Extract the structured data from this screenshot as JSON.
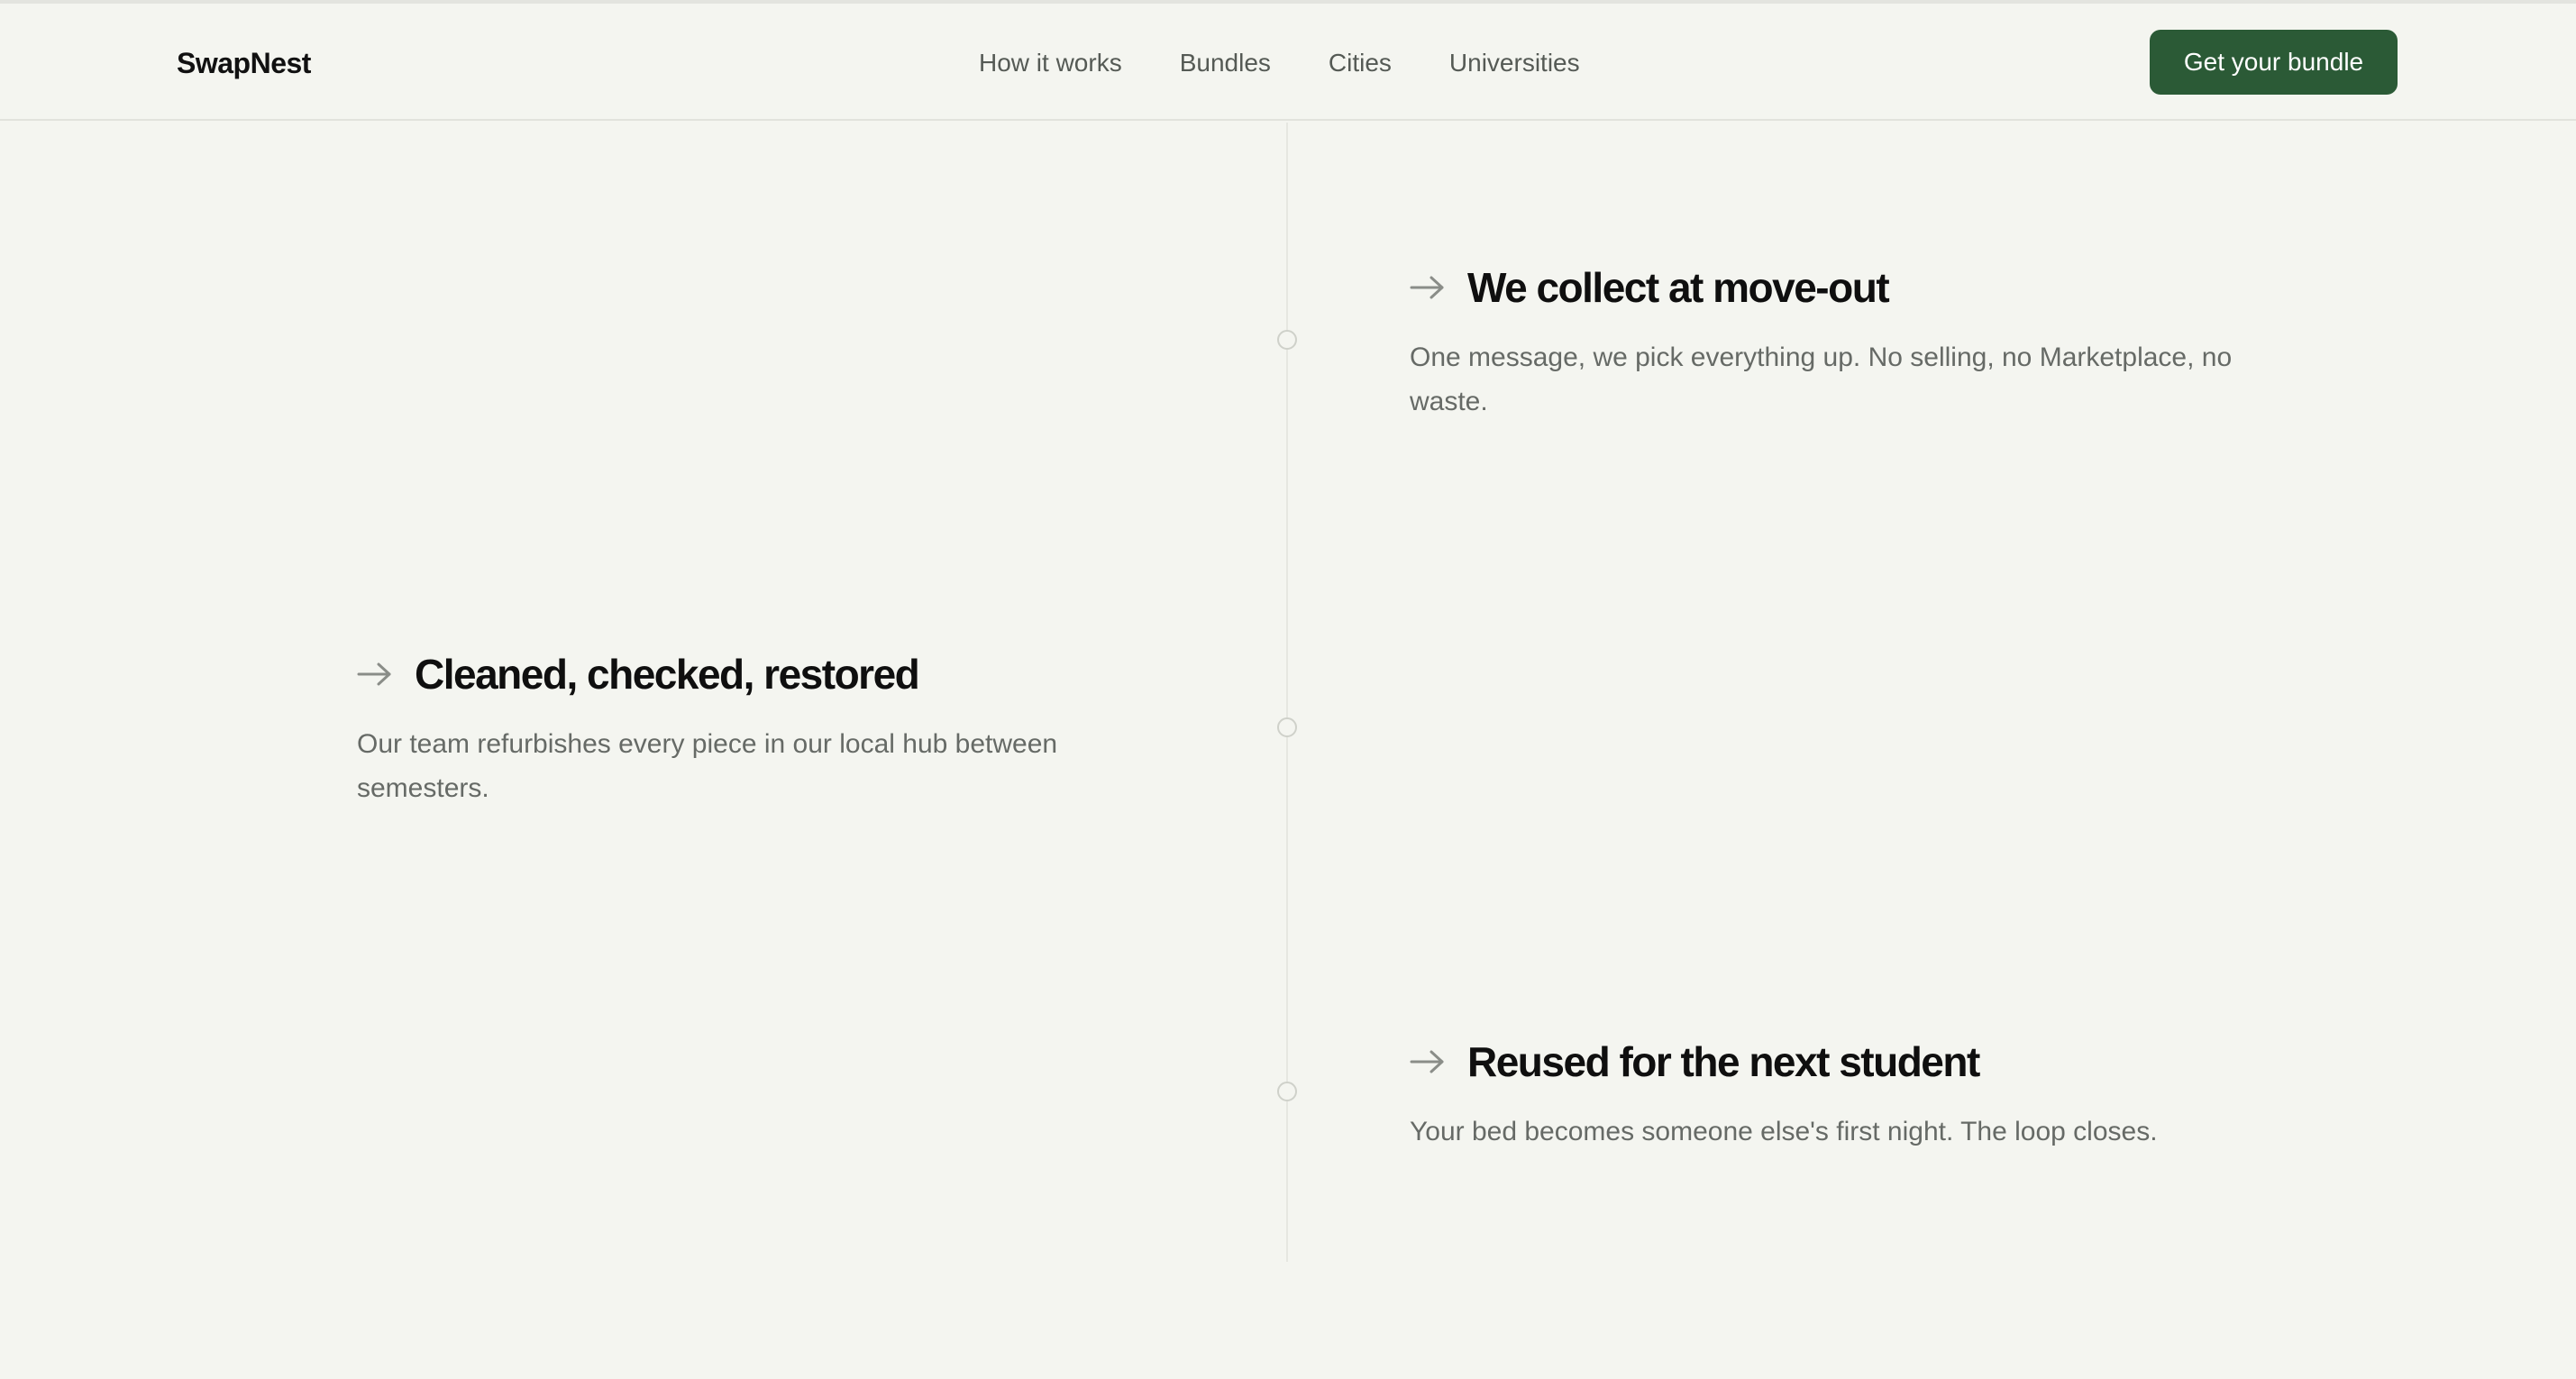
{
  "header": {
    "brand": "SwapNest",
    "nav": [
      "How it works",
      "Bundles",
      "Cities",
      "Universities"
    ],
    "cta_label": "Get your bundle"
  },
  "steps": [
    {
      "title": "We collect at move-out",
      "description": "One message, we pick everything up. No selling, no Marketplace, no waste.",
      "icon": "arrow-right-icon"
    },
    {
      "title": "Cleaned, checked, restored",
      "description": "Our team refurbishes every piece in our local hub between semesters.",
      "icon": "arrow-right-icon"
    },
    {
      "title": "Reused for the next student",
      "description": "Your bed becomes someone else's first night. The loop closes.",
      "icon": "arrow-right-icon"
    }
  ],
  "colors": {
    "background": "#f4f5f0",
    "accent": "#2b5a36",
    "text_muted": "#666a66"
  }
}
